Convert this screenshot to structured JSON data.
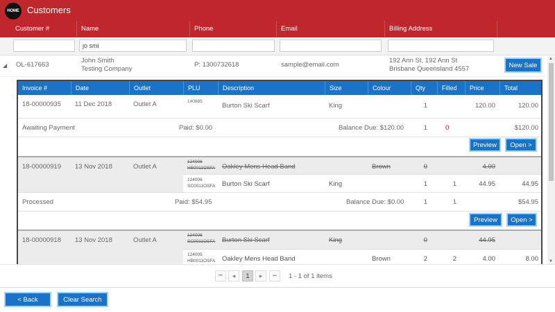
{
  "app": {
    "logo_text": "HOME",
    "title": "Customers"
  },
  "columns": [
    "Customer #",
    "Name",
    "Phone",
    "Email",
    "Billing Address"
  ],
  "filters": {
    "customer_no": "",
    "name": "jo smi",
    "phone": "",
    "email": "",
    "billing": ""
  },
  "customer": {
    "number": "OL-617663",
    "name": "John Smith",
    "company": "Testing Company",
    "phone": "P: 1300732618",
    "email": "sample@email.com",
    "address_line1": "192 Ann St, 192 Ann St",
    "address_line2": "Brisbane Queensland 4557",
    "new_sale_label": "New Sale"
  },
  "invoice_columns": [
    "Invoice #",
    "Date",
    "Outlet",
    "PLU",
    "Description",
    "Size",
    "Colour",
    "Qty",
    "Filled",
    "Price",
    "Total"
  ],
  "invoices": [
    {
      "number": "18-00000935",
      "date": "11 Dec 2018",
      "outlet": "Outlet A",
      "lines": [
        {
          "plu1": "140885",
          "plu2": "",
          "description": "Burton Ski Scarf",
          "size": "King",
          "colour": "",
          "qty": "1",
          "filled": "",
          "price": "120.00",
          "total": "120.00",
          "struck": false
        }
      ],
      "status": "Awaiting Payment",
      "paid": "Paid: $0.00",
      "balance": "Balance Due: $120.00",
      "sum_qty": "1",
      "sum_filled": "0",
      "sum_total": "$120.00",
      "preview_label": "Preview",
      "open_label": "Open >"
    },
    {
      "number": "18-00000919",
      "date": "13 Nov 2018",
      "outlet": "Outlet A",
      "lines": [
        {
          "plu1": "124006",
          "plu2": "HB0011OSFA",
          "description": "Oakley Mens Head Band",
          "size": "",
          "colour": "Brown",
          "qty": "0",
          "filled": "",
          "price": "4.00",
          "total": "",
          "struck": true
        },
        {
          "plu1": "124006",
          "plu2": "SC0011OSFA",
          "description": "Burton Ski Scarf",
          "size": "King",
          "colour": "",
          "qty": "1",
          "filled": "1",
          "price": "44.95",
          "total": "44.95",
          "struck": false
        }
      ],
      "status": "Processed",
      "paid": "Paid: $54.95",
      "balance": "Balance Due: $0.00",
      "sum_qty": "1",
      "sum_filled": "1",
      "sum_total": "$54.95",
      "preview_label": "Preview",
      "open_label": "Open >"
    },
    {
      "number": "18-00000918",
      "date": "13 Nov 2018",
      "outlet": "Outlet A",
      "lines": [
        {
          "plu1": "124006",
          "plu2": "SC0011OSFA",
          "description": "Burton Ski Scarf",
          "size": "King",
          "colour": "",
          "qty": "0",
          "filled": "",
          "price": "44.95",
          "total": "",
          "struck": true
        },
        {
          "plu1": "124005",
          "plu2": "HB0011OSFA",
          "description": "Oakley Mens Head Band",
          "size": "",
          "colour": "Brown",
          "qty": "2",
          "filled": "2",
          "price": "4.00",
          "total": "8.00",
          "struck": false
        }
      ]
    }
  ],
  "pager": {
    "current_page": "1",
    "info": "1 - 1 of 1 items",
    "first_icon": "first-page-icon",
    "prev_icon": "prev-page-icon",
    "next_icon": "next-page-icon",
    "last_icon": "last-page-icon"
  },
  "footer": {
    "back_label": "< Back",
    "clear_label": "Clear Search"
  },
  "colors": {
    "header_red": "#c0272d",
    "accent_blue": "#1a73c6",
    "button_glow": "#9fd3ff",
    "zero_filled": "#d0021b"
  }
}
